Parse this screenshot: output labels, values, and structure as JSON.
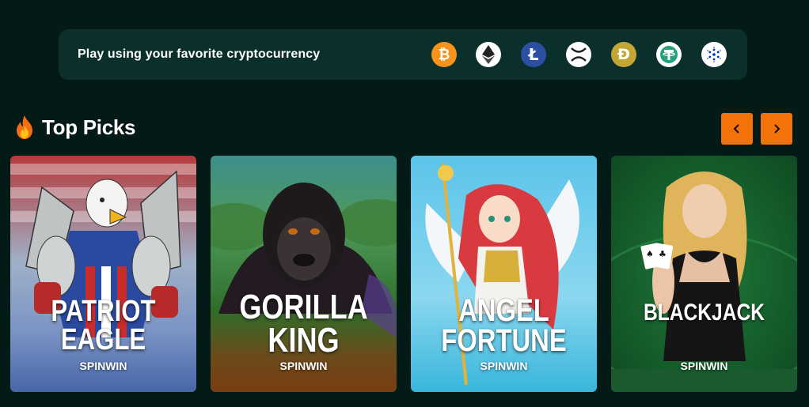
{
  "crypto_banner": {
    "text": "Play using your favorite cryptocurrency",
    "coins": [
      {
        "name": "bitcoin-icon",
        "symbol": "₿",
        "bg": "#f7931a",
        "fg": "#ffffff"
      },
      {
        "name": "ethereum-icon",
        "symbol": "◆",
        "bg": "#ffffff",
        "fg": "#1a1a1a"
      },
      {
        "name": "litecoin-icon",
        "symbol": "Ł",
        "bg": "#2c4fa3",
        "fg": "#ffffff"
      },
      {
        "name": "xrp-icon",
        "symbol": "✕",
        "bg": "#ffffff",
        "fg": "#1a1a1a"
      },
      {
        "name": "dogecoin-icon",
        "symbol": "Đ",
        "bg": "#c3a634",
        "fg": "#ffffff"
      },
      {
        "name": "tether-icon",
        "symbol": "₮",
        "bg": "#ffffff",
        "fg": "#26a17b"
      },
      {
        "name": "cardano-icon",
        "symbol": "✺",
        "bg": "#ffffff",
        "fg": "#0033ad"
      }
    ]
  },
  "section": {
    "title": "Top Picks",
    "prev_icon": "chevron-left-icon",
    "next_icon": "chevron-right-icon",
    "accent_color": "#f57208"
  },
  "games": [
    {
      "title_line1": "PATRIOT",
      "title_line2": "EAGLE",
      "provider": "SPINWIN"
    },
    {
      "title_line1": "GORILLA",
      "title_line2": "KING",
      "provider": "SPINWIN"
    },
    {
      "title_line1": "ANGEL",
      "title_line2": "FORTUNE",
      "provider": "SPINWIN"
    },
    {
      "title_line1": "BLACKJACK",
      "title_line2": "",
      "provider": "SPINWIN"
    }
  ]
}
